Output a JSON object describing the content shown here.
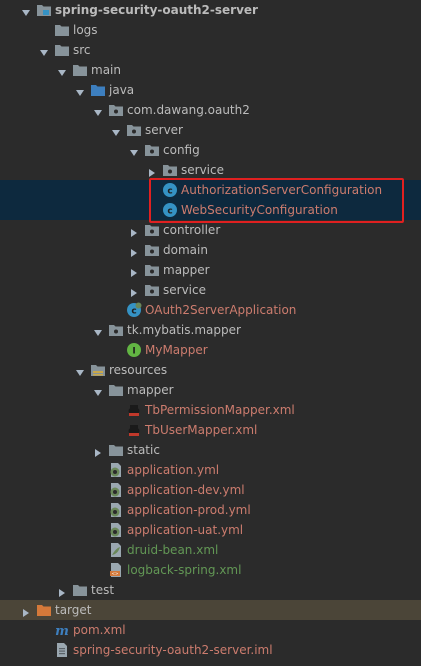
{
  "tree": {
    "items": [
      {
        "label": "spring-security-oauth2-server",
        "arrow": "expanded",
        "icon": "module-folder-icon",
        "style": "bold"
      },
      {
        "label": "logs",
        "arrow": "none",
        "icon": "folder-icon",
        "style": "normal"
      },
      {
        "label": "src",
        "arrow": "expanded",
        "icon": "folder-icon",
        "style": "normal"
      },
      {
        "label": "main",
        "arrow": "expanded",
        "icon": "folder-icon",
        "style": "normal"
      },
      {
        "label": "java",
        "arrow": "expanded",
        "icon": "source-root-folder-icon",
        "style": "normal"
      },
      {
        "label": "com.dawang.oauth2",
        "arrow": "expanded",
        "icon": "package-icon",
        "style": "normal"
      },
      {
        "label": "server",
        "arrow": "expanded",
        "icon": "package-icon",
        "style": "normal"
      },
      {
        "label": "config",
        "arrow": "expanded",
        "icon": "package-icon",
        "style": "normal"
      },
      {
        "label": "service",
        "arrow": "collapsed",
        "icon": "package-icon",
        "style": "normal"
      },
      {
        "label": "AuthorizationServerConfiguration",
        "arrow": "none",
        "icon": "java-class-icon",
        "style": "red"
      },
      {
        "label": "WebSecurityConfiguration",
        "arrow": "none",
        "icon": "java-class-icon",
        "style": "red"
      },
      {
        "label": "controller",
        "arrow": "collapsed",
        "icon": "package-icon",
        "style": "normal"
      },
      {
        "label": "domain",
        "arrow": "collapsed",
        "icon": "package-icon",
        "style": "normal"
      },
      {
        "label": "mapper",
        "arrow": "collapsed",
        "icon": "package-icon",
        "style": "normal"
      },
      {
        "label": "service",
        "arrow": "collapsed",
        "icon": "package-icon",
        "style": "normal"
      },
      {
        "label": "OAuth2ServerApplication",
        "arrow": "none",
        "icon": "spring-boot-class-icon",
        "style": "red"
      },
      {
        "label": "tk.mybatis.mapper",
        "arrow": "expanded",
        "icon": "package-icon",
        "style": "normal"
      },
      {
        "label": "MyMapper",
        "arrow": "none",
        "icon": "java-interface-icon",
        "style": "red"
      },
      {
        "label": "resources",
        "arrow": "expanded",
        "icon": "resources-folder-icon",
        "style": "normal"
      },
      {
        "label": "mapper",
        "arrow": "expanded",
        "icon": "folder-icon",
        "style": "normal"
      },
      {
        "label": "TbPermissionMapper.xml",
        "arrow": "none",
        "icon": "mybatis-xml-icon",
        "style": "red"
      },
      {
        "label": "TbUserMapper.xml",
        "arrow": "none",
        "icon": "mybatis-xml-icon",
        "style": "red"
      },
      {
        "label": "static",
        "arrow": "collapsed",
        "icon": "folder-icon",
        "style": "normal"
      },
      {
        "label": "application.yml",
        "arrow": "none",
        "icon": "spring-yml-icon",
        "style": "red"
      },
      {
        "label": "application-dev.yml",
        "arrow": "none",
        "icon": "spring-yml-icon",
        "style": "red"
      },
      {
        "label": "application-prod.yml",
        "arrow": "none",
        "icon": "spring-yml-icon",
        "style": "red"
      },
      {
        "label": "application-uat.yml",
        "arrow": "none",
        "icon": "spring-yml-icon",
        "style": "red"
      },
      {
        "label": "druid-bean.xml",
        "arrow": "none",
        "icon": "spring-xml-icon",
        "style": "green"
      },
      {
        "label": "logback-spring.xml",
        "arrow": "none",
        "icon": "logback-xml-icon",
        "style": "green"
      },
      {
        "label": "test",
        "arrow": "collapsed",
        "icon": "folder-icon",
        "style": "normal"
      },
      {
        "label": "target",
        "arrow": "collapsed",
        "icon": "excluded-folder-icon",
        "style": "normal"
      },
      {
        "label": "pom.xml",
        "arrow": "none",
        "icon": "maven-icon",
        "style": "red"
      },
      {
        "label": "spring-security-oauth2-server.iml",
        "arrow": "none",
        "icon": "iml-file-icon",
        "style": "red"
      }
    ]
  },
  "colors": {
    "background": "#2b2b2b",
    "selected_row": "#0d293e",
    "excluded_row": "#4b4538",
    "text_default": "#bbbbbb",
    "text_modified": "#cc7c6e",
    "text_added": "#629755",
    "annotation_box": "#e02020"
  }
}
